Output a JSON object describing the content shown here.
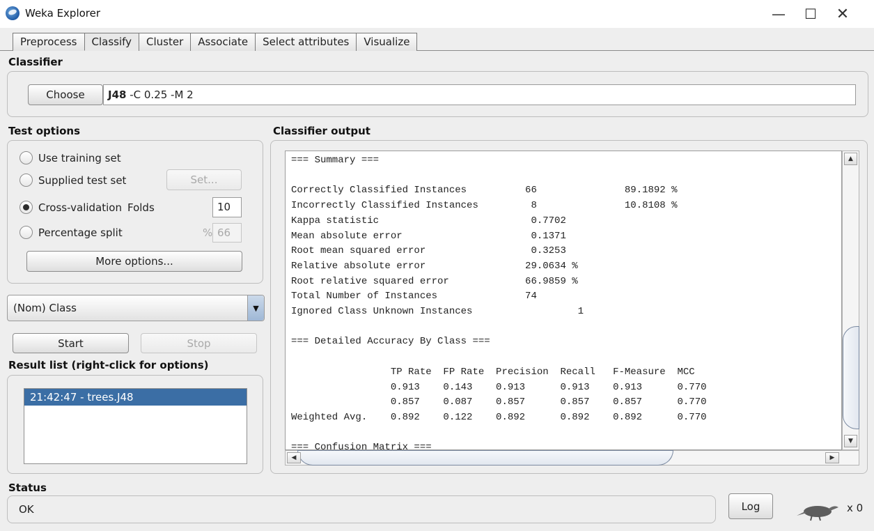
{
  "window": {
    "title": "Weka Explorer",
    "minimize_glyph": "—",
    "maximize_glyph": "☐",
    "close_glyph": "✕"
  },
  "tabs": [
    {
      "label": "Preprocess"
    },
    {
      "label": "Classify"
    },
    {
      "label": "Cluster"
    },
    {
      "label": "Associate"
    },
    {
      "label": "Select attributes"
    },
    {
      "label": "Visualize"
    }
  ],
  "classifier": {
    "title": "Classifier",
    "choose_label": "Choose",
    "name": "J48",
    "options": " -C 0.25 -M 2"
  },
  "test_options": {
    "title": "Test options",
    "use_training": "Use training set",
    "supplied_test": "Supplied test set",
    "set_label": "Set...",
    "cross_validation": "Cross-validation",
    "folds_label": "Folds",
    "folds_value": "10",
    "percentage_split": "Percentage split",
    "pct_symbol": "%",
    "pct_value": "66",
    "more_options": "More options...",
    "selected": "cross_validation"
  },
  "class_select": {
    "value": "(Nom) Class"
  },
  "run": {
    "start_label": "Start",
    "stop_label": "Stop"
  },
  "result_list": {
    "title": "Result list (right-click for options)",
    "items": [
      "21:42:47 - trees.J48"
    ]
  },
  "output": {
    "title": "Classifier output",
    "lines": [
      "=== Summary ===",
      "",
      "Correctly Classified Instances          66               89.1892 %",
      "Incorrectly Classified Instances         8               10.8108 %",
      "Kappa statistic                          0.7702",
      "Mean absolute error                      0.1371",
      "Root mean squared error                  0.3253",
      "Relative absolute error                 29.0634 %",
      "Root relative squared error             66.9859 %",
      "Total Number of Instances               74",
      "Ignored Class Unknown Instances                  1",
      "",
      "=== Detailed Accuracy By Class ===",
      "",
      "                 TP Rate  FP Rate  Precision  Recall   F-Measure  MCC",
      "                 0.913    0.143    0.913      0.913    0.913      0.770",
      "                 0.857    0.087    0.857      0.857    0.857      0.770",
      "Weighted Avg.    0.892    0.122    0.892      0.892    0.892      0.770",
      "",
      "=== Confusion Matrix ==="
    ]
  },
  "status": {
    "title": "Status",
    "text": "OK",
    "log_label": "Log",
    "count_label": "x 0"
  },
  "colors": {
    "selection": "#3b6ea5",
    "background": "#eeeeee",
    "scroll_thumb_border": "#7b8aa1"
  }
}
